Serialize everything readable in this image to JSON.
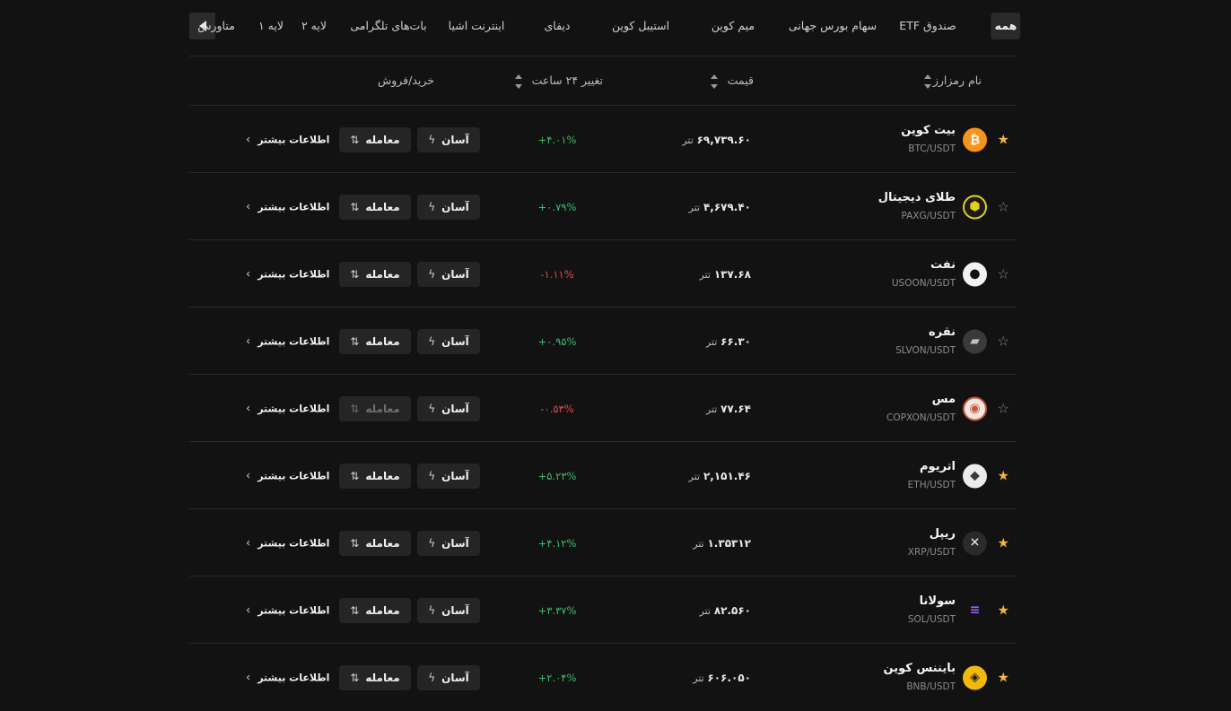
{
  "categories": [
    "همه",
    "صندوق ETF",
    "سهام بورس جهانی",
    "میم کوین",
    "استیبل کوین",
    "دیفای",
    "اینترنت اشیا",
    "بات‌های تلگرامی",
    "لایه ۲",
    "لایه ۱",
    "متاورس"
  ],
  "active_category": "همه",
  "table_header": {
    "name": "نام رمزارز",
    "price": "قیمت",
    "change": "تغییر ۲۴ ساعت",
    "trade": "خرید/فروش"
  },
  "row_buttons": {
    "easy": "آسان",
    "trade": "معامله",
    "more": "اطلاعات بیشتر"
  },
  "price_unit": "تتر",
  "rows": [
    {
      "name": "بیت کوین",
      "pair": "BTC/USDT",
      "price": "۶۹,۷۳۹.۶۰",
      "unit": "تتر",
      "change": "+۴.۰۱%",
      "direction": "up",
      "favorite": true,
      "icon": "bitcoin-icon",
      "trade_enabled": true
    },
    {
      "name": "طلای دیجیتال",
      "pair": "PAXG/USDT",
      "price": "۴,۶۷۹.۴۰",
      "unit": "تتر",
      "change": "+۰.۷۹%",
      "direction": "up",
      "favorite": false,
      "icon": "pax-gold-icon",
      "trade_enabled": true
    },
    {
      "name": "نفت",
      "pair": "USOON/USDT",
      "price": "۱۳۷.۶۸",
      "unit": "تتر",
      "change": "-۱.۱۱%",
      "direction": "down",
      "favorite": false,
      "icon": "oil-drop-icon",
      "trade_enabled": true
    },
    {
      "name": "نقره",
      "pair": "SLVON/USDT",
      "price": "۶۶.۳۰",
      "unit": "تتر",
      "change": "+۰.۹۵%",
      "direction": "up",
      "favorite": false,
      "icon": "silver-bars-icon",
      "trade_enabled": true
    },
    {
      "name": "مس",
      "pair": "COPXON/USDT",
      "price": "۷۷.۶۴",
      "unit": "تتر",
      "change": "-۰.۵۳%",
      "direction": "down",
      "favorite": false,
      "icon": "copper-icon",
      "trade_enabled": false
    },
    {
      "name": "اتریوم",
      "pair": "ETH/USDT",
      "price": "۲,۱۵۱.۴۶",
      "unit": "تتر",
      "change": "+۵.۲۳%",
      "direction": "up",
      "favorite": true,
      "icon": "ethereum-icon",
      "trade_enabled": true
    },
    {
      "name": "ریپل",
      "pair": "XRP/USDT",
      "price": "۱.۳۵۳۱۲",
      "unit": "تتر",
      "change": "+۴.۱۲%",
      "direction": "up",
      "favorite": true,
      "icon": "xrp-icon",
      "trade_enabled": true
    },
    {
      "name": "سولانا",
      "pair": "SOL/USDT",
      "price": "۸۲.۵۶۰",
      "unit": "تتر",
      "change": "+۳.۳۷%",
      "direction": "up",
      "favorite": true,
      "icon": "solana-icon",
      "trade_enabled": true
    },
    {
      "name": "بایننس کوین",
      "pair": "BNB/USDT",
      "price": "۶۰۶.۰۵۰",
      "unit": "تتر",
      "change": "+۲.۰۴%",
      "direction": "up",
      "favorite": true,
      "icon": "bnb-icon",
      "trade_enabled": true
    }
  ],
  "colors": {
    "background": "#121212",
    "up": "#3fba6f",
    "down": "#e5484d",
    "favorite_star": "#f5b73b",
    "button_bg": "#252525"
  }
}
